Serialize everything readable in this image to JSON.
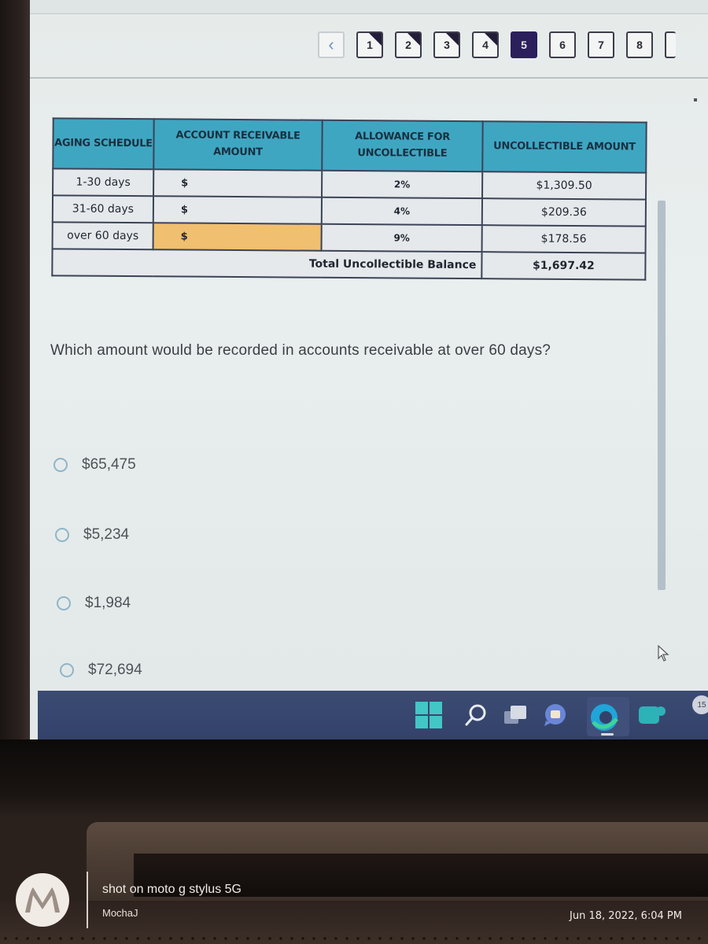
{
  "pager": {
    "prev_icon": "chevron-left-icon",
    "pages": [
      {
        "label": "1",
        "state": "answered"
      },
      {
        "label": "2",
        "state": "answered"
      },
      {
        "label": "3",
        "state": "answered"
      },
      {
        "label": "4",
        "state": "answered"
      },
      {
        "label": "5",
        "state": "current"
      },
      {
        "label": "6",
        "state": "unanswered"
      },
      {
        "label": "7",
        "state": "unanswered"
      },
      {
        "label": "8",
        "state": "unanswered"
      }
    ]
  },
  "table": {
    "headers": [
      "AGING SCHEDULE",
      "ACCOUNT RECEIVABLE AMOUNT",
      "ALLOWANCE FOR UNCOLLECTIBLE",
      "UNCOLLECTIBLE AMOUNT"
    ],
    "rows": [
      {
        "aging": "1-30 days",
        "amount": "$",
        "allowance": "2%",
        "uncollectible": "$1,309.50",
        "highlight": false
      },
      {
        "aging": "31-60 days",
        "amount": "$",
        "allowance": "4%",
        "uncollectible": "$209.36",
        "highlight": false
      },
      {
        "aging": "over 60 days",
        "amount": "$",
        "allowance": "9%",
        "uncollectible": "$178.56",
        "highlight": true
      }
    ],
    "total_label": "Total Uncollectible Balance",
    "total_value": "$1,697.42",
    "colors": {
      "header": "#3fa6c2",
      "highlight": "#f0bf6f"
    }
  },
  "question": {
    "text": "Which amount would be recorded in accounts receivable at over 60 days?",
    "options": [
      "$65,475",
      "$5,234",
      "$1,984",
      "$72,694"
    ]
  },
  "taskbar": {
    "icons": [
      "windows-start-icon",
      "search-icon",
      "task-view-icon",
      "chat-icon",
      "edge-browser-icon",
      "teams-icon"
    ],
    "badge_count": "15"
  },
  "watermark": {
    "line1": "shot on moto g stylus 5G",
    "line2": "MochaJ",
    "date": "Jun 18, 2022, 6:04 PM"
  }
}
